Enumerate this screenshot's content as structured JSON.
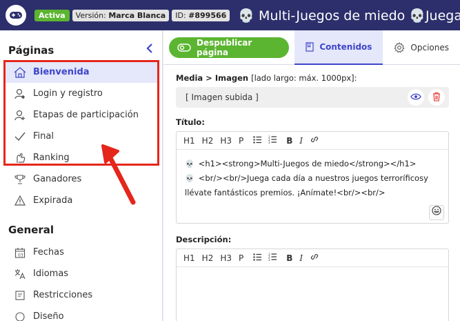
{
  "topbar": {
    "status": "Activa",
    "version_label": "Versión:",
    "version_value": "Marca Blanca",
    "id_label": "ID:",
    "id_value": "#899566",
    "title": "💀 Multi-Juegos de miedo 💀Juega"
  },
  "sidebar": {
    "pages_title": "Páginas",
    "pages": [
      {
        "label": "Bienvenida",
        "icon": "home-icon"
      },
      {
        "label": "Login y registro",
        "icon": "user-icon"
      },
      {
        "label": "Etapas de participación",
        "icon": "user-add-icon"
      },
      {
        "label": "Final",
        "icon": "check-icon"
      },
      {
        "label": "Ranking",
        "icon": "hand-icon"
      },
      {
        "label": "Ganadores",
        "icon": "trophy-icon"
      },
      {
        "label": "Expirada",
        "icon": "warning-icon"
      }
    ],
    "general_title": "General",
    "general": [
      {
        "label": "Fechas",
        "icon": "calendar-icon"
      },
      {
        "label": "Idiomas",
        "icon": "translate-icon"
      },
      {
        "label": "Restricciones",
        "icon": "restrictions-icon"
      },
      {
        "label": "Diseño",
        "icon": "design-icon"
      }
    ]
  },
  "main": {
    "unpublish_label": "Despublicar página",
    "tab_contents": "Contenidos",
    "tab_options": "Opciones",
    "media_label": "Media > Imagen",
    "media_hint": "[lado largo: máx. 1000px]:",
    "image_value": "[ Imagen subida ]",
    "title_label": "Título:",
    "title_line1": "<h1><strong>Multi-Juegos de miedo</strong></h1>",
    "title_line2": "<br/><br/>Juega cada día a nuestros juegos terroríficosy llévate fantásticos premios. ¡Anímate!<br/><br/>",
    "description_label": "Descripción:",
    "toolbar": [
      "H1",
      "H2",
      "H3",
      "P"
    ]
  },
  "colors": {
    "brand": "#2c2f6b",
    "accent": "#3d45c9",
    "success": "#5cb531",
    "danger": "#e5261b"
  }
}
